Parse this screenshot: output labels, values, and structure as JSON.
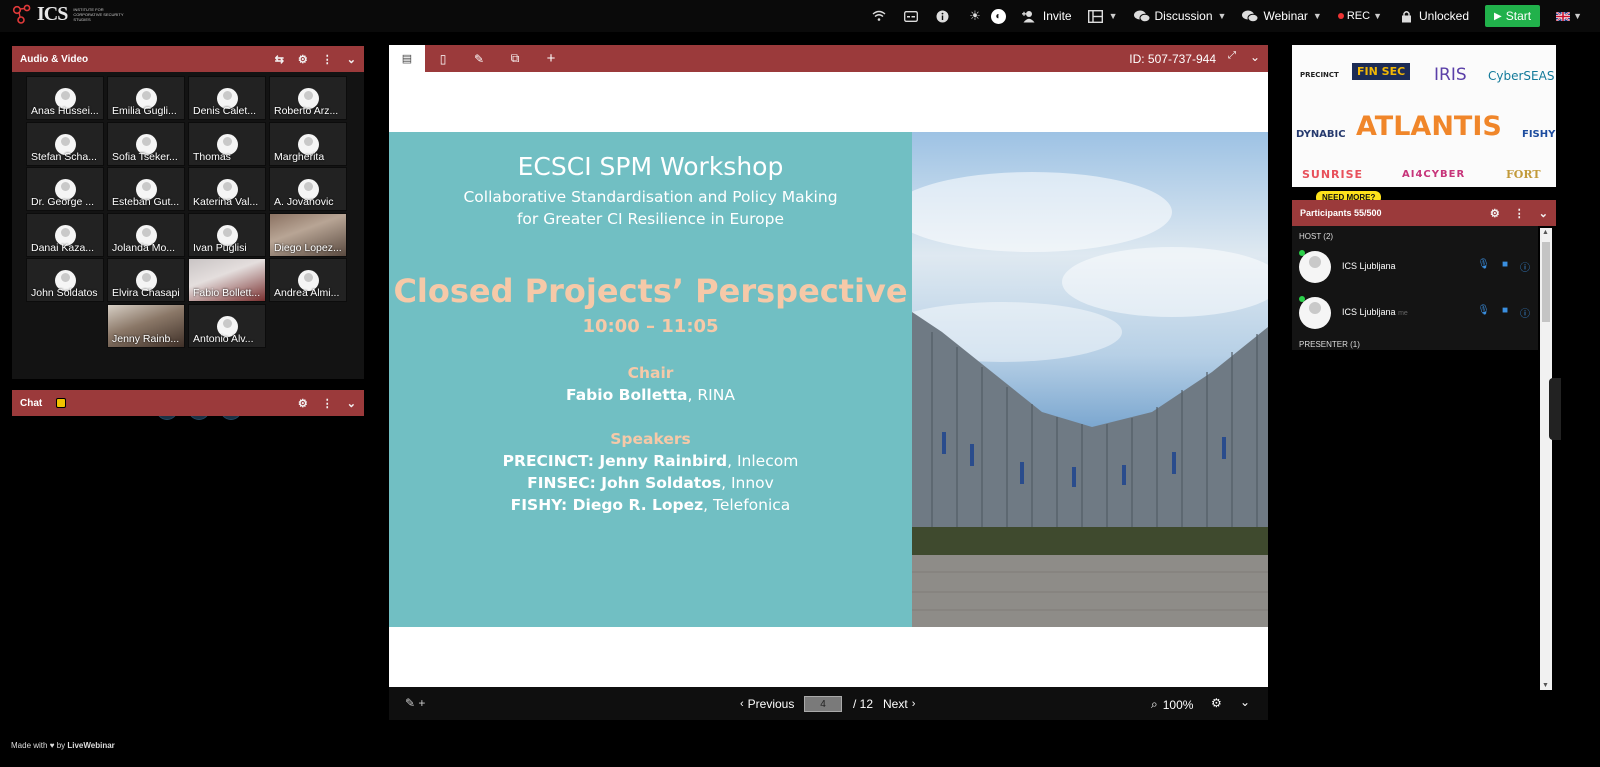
{
  "topbar": {
    "logo_text": "ICS",
    "logo_sub": "INSTITUTE FOR CORPORATIVE SECURITY STUDIES",
    "invite": "Invite",
    "discussion": "Discussion",
    "webinar": "Webinar",
    "rec": "REC",
    "unlocked": "Unlocked",
    "start": "Start"
  },
  "av_panel": {
    "title": "Audio & Video",
    "participants": [
      "Anas Hussei...",
      "Emilia Gugli...",
      "Denis Calet...",
      "Roberto Arz...",
      "Stefan Scha...",
      "Sofia Tseker...",
      "Thomas",
      "Margherita",
      "Dr. George ...",
      "Esteban Gut...",
      "Katerina Val...",
      "A. Jovanovic",
      "Danai Kaza...",
      "Jolanda Mo...",
      "Ivan Puglisi",
      "Diego Lopez...",
      "John Soldatos",
      "Elvira Chasapi",
      "Fabio Bollett...",
      "Andrea Almi...",
      "Jenny Rainb...",
      "Antonio Alv..."
    ]
  },
  "chat_panel": {
    "title": "Chat"
  },
  "presentation": {
    "id": "ID: 507-737-944",
    "previous": "Previous",
    "next": "Next",
    "page": "4",
    "total": "/ 12",
    "zoom": "100%",
    "slide": {
      "title": "ECSCI SPM Workshop",
      "subtitle_1": "Collaborative Standardisation and Policy Making",
      "subtitle_2": "for Greater CI Resilience in Europe",
      "session": "Closed Projects’ Perspective",
      "time": "10:00 – 11:05",
      "chair_heading": "Chair",
      "chair_name": "Fabio Bolletta",
      "chair_org": ", RINA",
      "speakers_heading": "Speakers",
      "speakers": [
        {
          "project": "PRECINCT: ",
          "name": "Jenny Rainbird",
          "org": ", Inlecom"
        },
        {
          "project": "FINSEC: ",
          "name": "John Soldatos",
          "org": ", Innov"
        },
        {
          "project": "FISHY: ",
          "name": "Diego R. Lopez",
          "org": ", Telefonica"
        }
      ]
    }
  },
  "ads": {
    "logos": [
      "PRECINCT",
      "FIN SEC",
      "IRIS",
      "CyberSEAS",
      "DYNABIC",
      "ATLANTIS",
      "FISHY",
      "SUNRISE",
      "AI4CYBER",
      "FORT"
    ],
    "need_more": "NEED MORE?"
  },
  "participants_panel": {
    "title": "Participants 55/500",
    "host_group": "HOST (2)",
    "hosts": [
      "ICS Ljubljana",
      "ICS Ljubljana"
    ],
    "me_tag": "me",
    "presenter_group": "PRESENTER (1)"
  },
  "footer": {
    "made_with": "Made with",
    "by": "by",
    "brand": "LiveWebinar"
  },
  "colors": {
    "panel_header": "#9b3a3b",
    "slide_bg": "#71bfc3",
    "slide_accent": "#f6c9a8",
    "start_green": "#21b14b"
  }
}
